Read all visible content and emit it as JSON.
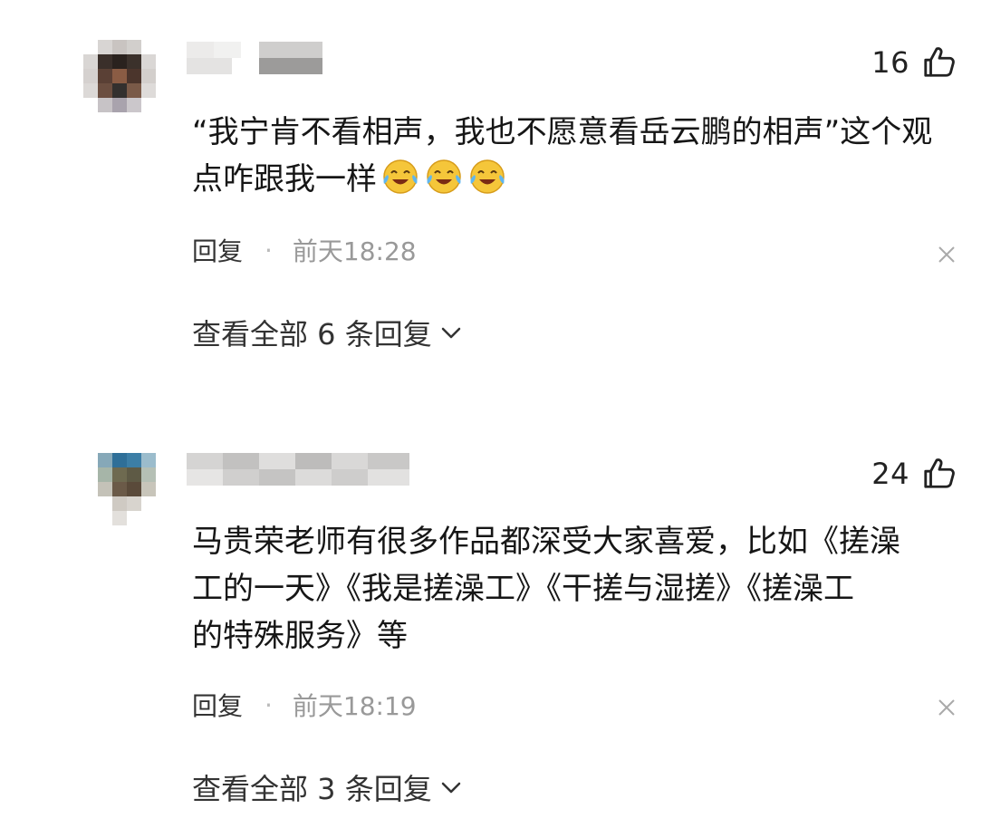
{
  "colors": {
    "text": "#161616",
    "meta": "#999999",
    "background": "#ffffff"
  },
  "comments": [
    {
      "avatar": "blurred-avatar",
      "username": "",
      "likes": "16",
      "text_part1": "“我宁肯不看相声，我也不愿意看岳云鹏的相声”这个观",
      "text_part2": "点咋跟我一样",
      "emoji": "laughing-crying-emoji",
      "reply_label": "回复",
      "separator": "·",
      "time": "前天18:28",
      "view_all": "查看全部 6 条回复"
    },
    {
      "avatar": "blurred-avatar",
      "username": "",
      "likes": "24",
      "text_line1": "马贵荣老师有很多作品都深受大家喜爱，比如《搓澡",
      "text_line2": "工的一天》《我是搓澡工》《干搓与湿搓》《搓澡工",
      "text_line3": "的特殊服务》等",
      "reply_label": "回复",
      "separator": "·",
      "time": "前天18:19",
      "view_all": "查看全部 3 条回复"
    }
  ]
}
